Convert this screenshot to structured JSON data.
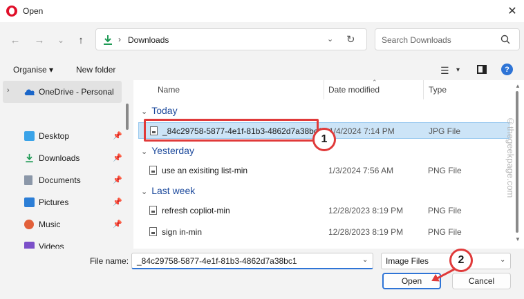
{
  "window": {
    "title": "Open",
    "close_glyph": "✕"
  },
  "nav": {
    "back": "←",
    "forward": "→",
    "recent": "⌄",
    "up": "↑"
  },
  "address": {
    "chevron": "›",
    "location": "Downloads",
    "dropdown": "⌄",
    "refresh": "↻"
  },
  "search": {
    "placeholder": "Search Downloads"
  },
  "toolbar": {
    "organise": "Organise ▾",
    "new_folder": "New folder",
    "view_glyph": "☰",
    "view_dropdown": "▾",
    "help": "?"
  },
  "sidebar": {
    "onedrive": "OneDrive - Personal",
    "chevron": "›",
    "pin_glyph": "📌",
    "items": [
      {
        "label": "Desktop"
      },
      {
        "label": "Downloads"
      },
      {
        "label": "Documents"
      },
      {
        "label": "Pictures"
      },
      {
        "label": "Music"
      },
      {
        "label": "Videos"
      }
    ]
  },
  "columns": {
    "name": "Name",
    "date": "Date modified",
    "type": "Type",
    "sort_caret": "⌃"
  },
  "groups": {
    "chevron": "⌄",
    "today": "Today",
    "yesterday": "Yesterday",
    "last_week": "Last week"
  },
  "files": [
    {
      "name": "_84c29758-5877-4e1f-81b3-4862d7a38bc1",
      "date": "1/4/2024 7:14 PM",
      "type": "JPG File"
    },
    {
      "name": "use an exisiting list-min",
      "date": "1/3/2024 7:56 AM",
      "type": "PNG File"
    },
    {
      "name": "refresh copliot-min",
      "date": "12/28/2023 8:19 PM",
      "type": "PNG File"
    },
    {
      "name": "sign in-min",
      "date": "12/28/2023 8:19 PM",
      "type": "PNG File"
    }
  ],
  "scrollbar": {
    "up": "▲",
    "down": "▼"
  },
  "watermark": "©thegeekpage.com",
  "footer": {
    "file_name_label": "File name:",
    "file_name_value": "_84c29758-5877-4e1f-81b3-4862d7a38bc1",
    "dropdown": "⌄",
    "file_type": "Image Files",
    "open": "Open",
    "cancel": "Cancel"
  },
  "annotations": {
    "step1": "1",
    "step2": "2"
  }
}
